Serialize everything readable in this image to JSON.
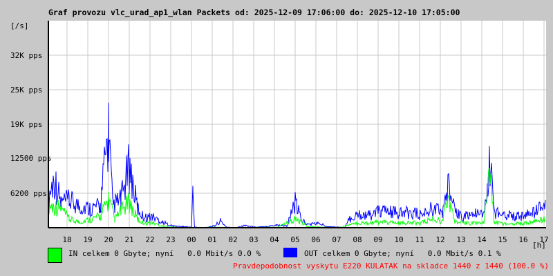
{
  "chart_data": {
    "type": "line",
    "title": "Graf provozu vlc_urad_ap1_wlan Packets od: 2025-12-09 17:06:00 do: 2025-12-10 17:05:00",
    "ylabel": "[/s]",
    "xlabel": "[h]",
    "ylim": [
      0,
      37200
    ],
    "yticks": [
      {
        "v": 6200,
        "label": "6200 pps"
      },
      {
        "v": 12500,
        "label": "12500 pps"
      },
      {
        "v": 18600,
        "label": "19K pps"
      },
      {
        "v": 24800,
        "label": "25K pps"
      },
      {
        "v": 31000,
        "label": "32K pps"
      }
    ],
    "xticks": [
      "18",
      "19",
      "20",
      "21",
      "22",
      "23",
      "00",
      "01",
      "02",
      "03",
      "04",
      "05",
      "06",
      "07",
      "08",
      "09",
      "10",
      "11",
      "12",
      "13",
      "14",
      "15",
      "16",
      "17"
    ],
    "x_unit": "hours since start",
    "grid": true,
    "series": [
      {
        "name": "OUT",
        "color": "#0000ff",
        "points": [
          [
            0,
            5600
          ],
          [
            0.3,
            8800
          ],
          [
            0.6,
            4500
          ],
          [
            1,
            4800
          ],
          [
            1.5,
            3900
          ],
          [
            2,
            3500
          ],
          [
            2.5,
            3800
          ],
          [
            2.9,
            17500
          ],
          [
            3.1,
            4000
          ],
          [
            3.5,
            5000
          ],
          [
            3.9,
            11000
          ],
          [
            4.3,
            3500
          ],
          [
            4.6,
            1800
          ],
          [
            5,
            2000
          ],
          [
            5.5,
            1000
          ],
          [
            6,
            300
          ],
          [
            6.5,
            200
          ],
          [
            6.9,
            100
          ],
          [
            6.97,
            6500
          ],
          [
            7.05,
            100
          ],
          [
            7.5,
            0
          ],
          [
            8,
            300
          ],
          [
            8.3,
            1200
          ],
          [
            8.6,
            100
          ],
          [
            9,
            0
          ],
          [
            9.5,
            400
          ],
          [
            10,
            100
          ],
          [
            10.5,
            200
          ],
          [
            11,
            500
          ],
          [
            11.5,
            300
          ],
          [
            11.9,
            4500
          ],
          [
            12.2,
            1500
          ],
          [
            12.5,
            600
          ],
          [
            13,
            800
          ],
          [
            13.5,
            200
          ],
          [
            14,
            100
          ],
          [
            14.3,
            0
          ],
          [
            14.5,
            1500
          ],
          [
            15,
            2500
          ],
          [
            15.5,
            2200
          ],
          [
            16,
            3000
          ],
          [
            16.5,
            2800
          ],
          [
            17,
            2500
          ],
          [
            17.5,
            2800
          ],
          [
            18,
            2200
          ],
          [
            18.5,
            3500
          ],
          [
            19,
            2800
          ],
          [
            19.3,
            7500
          ],
          [
            19.6,
            2600
          ],
          [
            20,
            2000
          ],
          [
            20.5,
            2500
          ],
          [
            21,
            2200
          ],
          [
            21.3,
            11500
          ],
          [
            21.5,
            2800
          ],
          [
            22,
            2500
          ],
          [
            22.5,
            2000
          ],
          [
            23,
            2200
          ],
          [
            23.5,
            2800
          ],
          [
            24,
            4500
          ]
        ]
      },
      {
        "name": "IN",
        "color": "#00ff00",
        "points": [
          [
            0,
            4000
          ],
          [
            0.6,
            3500
          ],
          [
            1,
            1500
          ],
          [
            1.5,
            1000
          ],
          [
            2,
            1500
          ],
          [
            2.5,
            2000
          ],
          [
            2.9,
            5000
          ],
          [
            3.2,
            1500
          ],
          [
            3.5,
            3000
          ],
          [
            3.9,
            4500
          ],
          [
            4.3,
            1500
          ],
          [
            4.6,
            800
          ],
          [
            5,
            900
          ],
          [
            5.5,
            300
          ],
          [
            6,
            100
          ],
          [
            7,
            0
          ],
          [
            8,
            100
          ],
          [
            9,
            0
          ],
          [
            11,
            100
          ],
          [
            11.9,
            1500
          ],
          [
            12.5,
            200
          ],
          [
            14,
            0
          ],
          [
            14.5,
            500
          ],
          [
            15,
            800
          ],
          [
            16,
            1000
          ],
          [
            17,
            800
          ],
          [
            18,
            900
          ],
          [
            18.5,
            1500
          ],
          [
            19,
            1200
          ],
          [
            19.3,
            5500
          ],
          [
            19.6,
            1000
          ],
          [
            20,
            800
          ],
          [
            21,
            900
          ],
          [
            21.3,
            9500
          ],
          [
            21.5,
            1000
          ],
          [
            22,
            700
          ],
          [
            23,
            800
          ],
          [
            24,
            1500
          ]
        ]
      }
    ]
  },
  "legend": {
    "in_text": "IN celkem 0 Gbyte; nyní   0.0 Mbit/s 0.0 %",
    "out_text": "OUT celkem 0 Gbyte; nyní   0.0 Mbit/s 0.1 %",
    "in_color": "#00ff00",
    "out_color": "#0000ff"
  },
  "footer": "Pravdepodobnost vyskytu E220 KULATAK na skladce 1440 z 1440 (100.0 %)"
}
